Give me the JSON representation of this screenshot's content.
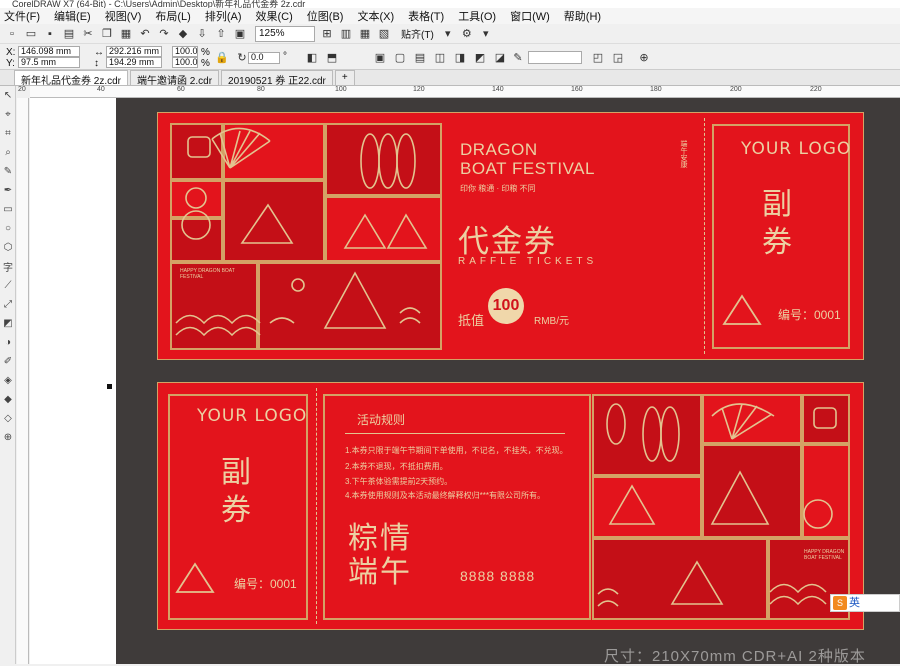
{
  "window": {
    "title": "CorelDRAW X7 (64-Bit) - C:\\Users\\Admin\\Desktop\\新年礼品代金券 2z.cdr"
  },
  "menu": [
    "文件(F)",
    "编辑(E)",
    "视图(V)",
    "布局(L)",
    "排列(A)",
    "效果(C)",
    "位图(B)",
    "文本(X)",
    "表格(T)",
    "工具(O)",
    "窗口(W)",
    "帮助(H)"
  ],
  "toolbar": {
    "zoom": "125%",
    "snap_label": "贴齐(T)"
  },
  "properties": {
    "x_label": "X:",
    "x_value": "146.098 mm",
    "y_label": "Y:",
    "y_value": "97.5 mm",
    "w_value": "292.216 mm",
    "h_value": "194.29 mm",
    "scale_w": "100.0",
    "scale_h": "100.0",
    "pct": "%",
    "rotation": "0.0",
    "deg": "°"
  },
  "tabs": [
    "新年礼品代金券 2z.cdr",
    "端午邀请函 2.cdr",
    "20190521 券 正22.cdr",
    "+"
  ],
  "ruler": {
    "h_ticks": [
      "20",
      "40",
      "60",
      "80",
      "100",
      "120",
      "140",
      "160",
      "180",
      "200",
      "220"
    ]
  },
  "ticket_top": {
    "title_line1": "DRAGON",
    "title_line2": "BOAT FESTIVAL",
    "subtitle": "印你 粮通 · 印粮 不同",
    "main_label": "代金券",
    "raffle": "RAFFLE TICKETS",
    "worth_label": "抵值",
    "amount": "100",
    "unit": "RMB/元",
    "vertical_note": "端午安康",
    "stub_logo": "YOUR LOGO",
    "stub_title_1": "副",
    "stub_title_2": "券",
    "serial": "编号：0001",
    "happy": "HAPPY DRAGON BOAT FESTIVAL"
  },
  "ticket_bottom": {
    "stub_logo": "YOUR LOGO",
    "stub_title_1": "副",
    "stub_title_2": "券",
    "serial": "编号：0001",
    "rules_title": "活动规则",
    "rules": [
      "1.本券只限于端午节期间下单使用，不记名，不挂失，不兑现。",
      "2.本券不退现，不抵扣费用。",
      "3.下午茶体验需提前2天预约。",
      "4.本券使用规则及本活动最终解释权归***有限公司所有。"
    ],
    "slogan_line1": "粽情",
    "slogan_line2": "端午",
    "phone": "8888 8888",
    "happy": "HAPPY DRAGON BOAT FESTIVAL"
  },
  "footer": {
    "size_text": "尺寸：210X70mm   CDR+AI 2种版本"
  },
  "ime": {
    "label": "英",
    "logo": "S"
  },
  "colors": {
    "ticket_red": "#e3141c",
    "gold": "#d4a265",
    "page_dark": "#3f3b3a"
  }
}
